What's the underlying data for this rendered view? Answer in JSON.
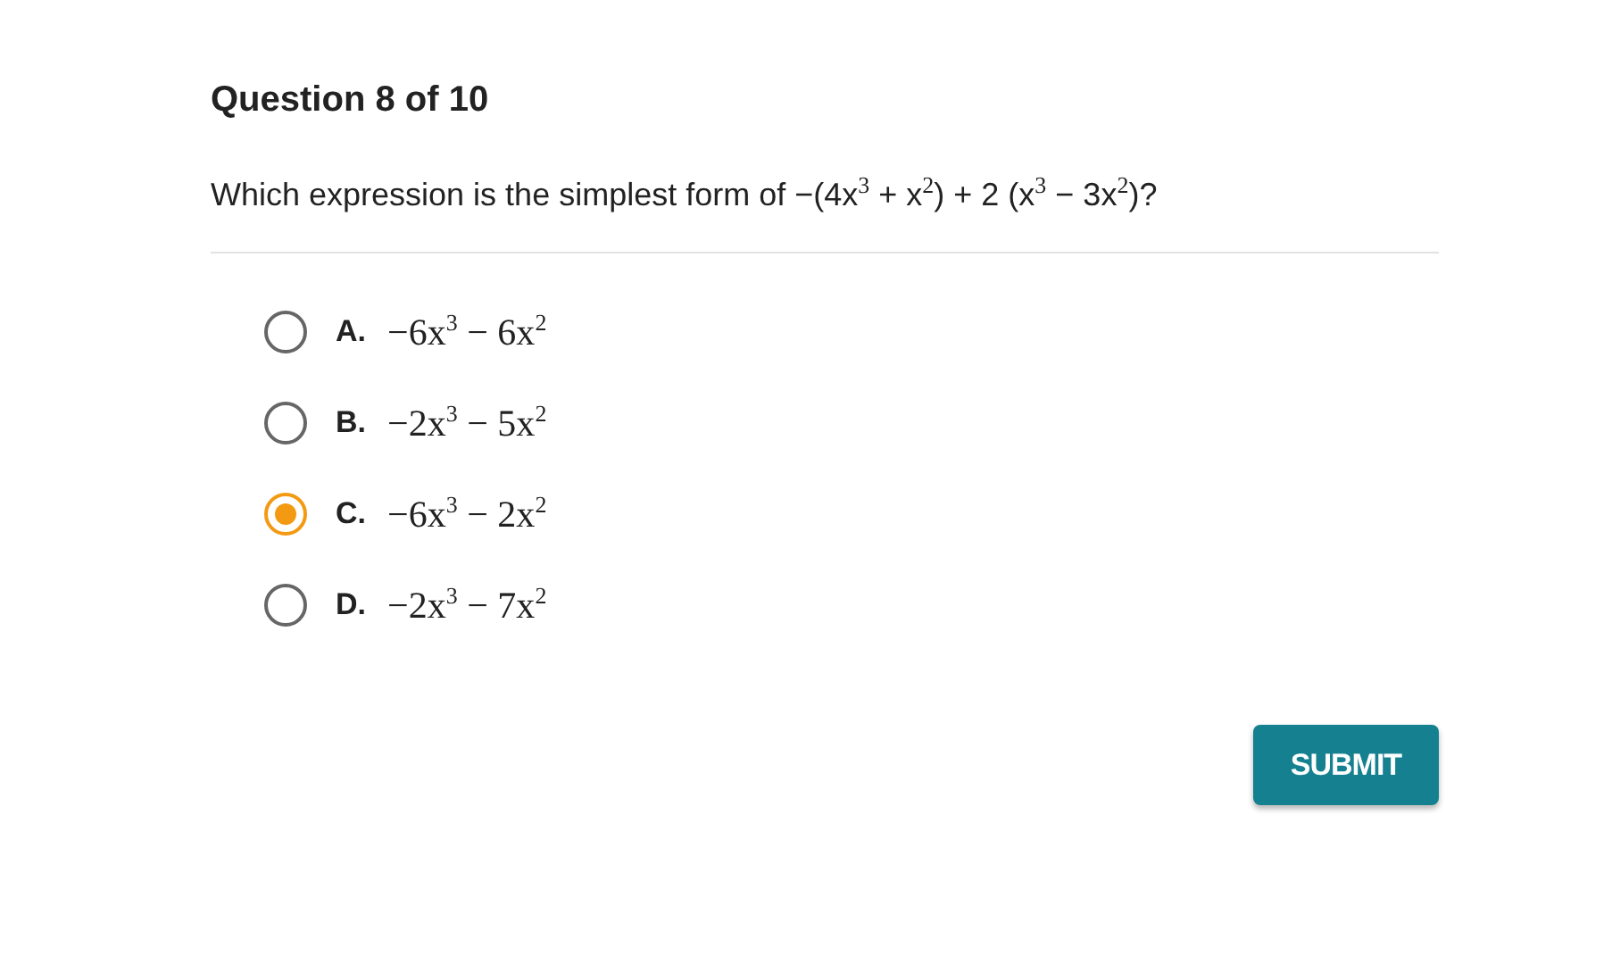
{
  "title": "Question 8 of 10",
  "question": "Which expression is the simplest form of −(4x$^{3}$ + x$^{2}$) + 2 (x$^{3}$ − 3x$^{2}$)?",
  "options": [
    {
      "letter": "A.",
      "expression": "−6x$^{3}$ − 6x$^{2}$",
      "selected": false
    },
    {
      "letter": "B.",
      "expression": "−2x$^{3}$ − 5x$^{2}$",
      "selected": false
    },
    {
      "letter": "C.",
      "expression": "−6x$^{3}$ − 2x$^{2}$",
      "selected": true
    },
    {
      "letter": "D.",
      "expression": "−2x$^{3}$ − 7x$^{2}$",
      "selected": false
    }
  ],
  "submit": "SUBMIT"
}
